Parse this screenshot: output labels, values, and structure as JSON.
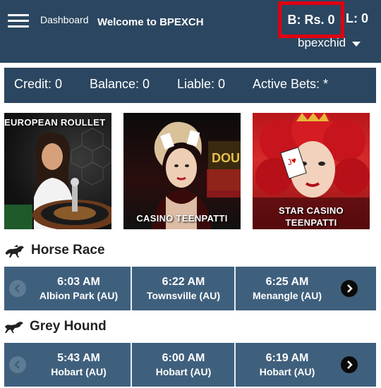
{
  "header": {
    "dashboard_label": "Dashboard",
    "welcome_text": "Welcome to BPEXCH",
    "balance_text": "B: Rs. 0",
    "liability_text": "L: 0",
    "username": "bpexchid"
  },
  "info_bar": {
    "credit": "Credit: 0",
    "balance": "Balance: 0",
    "liable": "Liable: 0",
    "active_bets": "Active Bets: *"
  },
  "banners": [
    {
      "caption": "EUROPEAN ROULLET"
    },
    {
      "caption": "CASINO TEENPATTI"
    },
    {
      "caption_line1": "STAR CASINO",
      "caption_line2": "TEENPATTI"
    }
  ],
  "horse_race": {
    "title": "Horse Race",
    "races": [
      {
        "time": "6:03 AM",
        "place": "Albion Park (AU)"
      },
      {
        "time": "6:22 AM",
        "place": "Townsville (AU)"
      },
      {
        "time": "6:25 AM",
        "place": "Menangle (AU)"
      }
    ]
  },
  "grey_hound": {
    "title": "Grey Hound",
    "races": [
      {
        "time": "5:43 AM",
        "place": "Hobart (AU)"
      },
      {
        "time": "6:00 AM",
        "place": "Hobart (AU)"
      },
      {
        "time": "6:19 AM",
        "place": "Hobart (AU)"
      }
    ]
  },
  "colors": {
    "header_bg": "#2b4660",
    "race_row_bg": "#3f607d",
    "highlight_border": "#e00010"
  }
}
